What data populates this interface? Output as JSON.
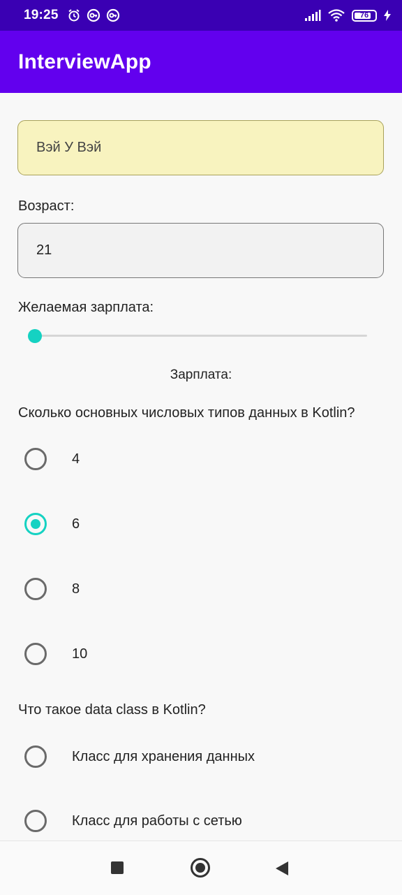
{
  "status_bar": {
    "time": "19:25",
    "battery_level": "76"
  },
  "app_bar": {
    "title": "InterviewApp"
  },
  "form": {
    "name_value": "Вэй У Вэй",
    "age_label": "Возраст:",
    "age_value": "21",
    "salary_wish_label": "Желаемая зарплата:",
    "salary_slider_fraction": 0.0,
    "salary_label": "Зарплата:"
  },
  "questions": [
    {
      "text": "Сколько основных числовых типов данных в Kotlin?",
      "options": [
        "4",
        "6",
        "8",
        "10"
      ],
      "selected_index": 1
    },
    {
      "text": "Что такое data class в Kotlin?",
      "options": [
        "Класс для хранения данных",
        "Класс для работы с сетью"
      ],
      "selected_index": null
    }
  ],
  "colors": {
    "status_bar": "#3a00b3",
    "app_bar": "#6200ee",
    "accent": "#15d2c2",
    "name_field_bg": "#f8f3bf"
  }
}
